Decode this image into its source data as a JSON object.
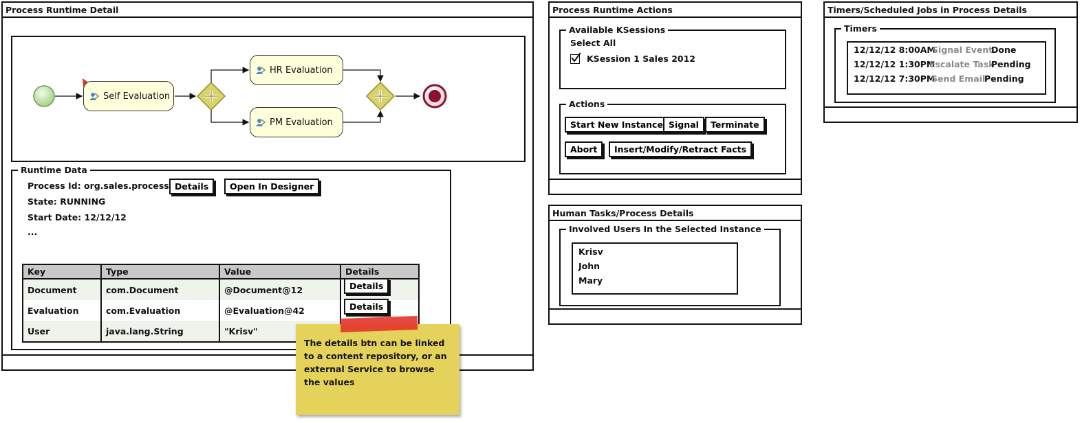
{
  "runtime_detail": {
    "title": "Process Runtime Detail",
    "diagram": {
      "tasks": [
        {
          "label": "Self Evaluation"
        },
        {
          "label": "HR Evaluation"
        },
        {
          "label": "PM Evaluation"
        }
      ],
      "colors": {
        "start": "#b9e3a0",
        "end": "#8e1030",
        "gateway": "#c6c24a",
        "task": "#ffffdc",
        "marker": "#e4342a"
      }
    },
    "runtime_data": {
      "legend": "Runtime Data",
      "process_id": "Process Id: org.sales.process",
      "state": "State: RUNNING",
      "start_date": "Start Date: 12/12/12",
      "more": "...",
      "details_button": "Details",
      "open_designer_button": "Open In Designer",
      "table": {
        "headers": [
          "Key",
          "Type",
          "Value",
          "Details"
        ],
        "rows": [
          {
            "key": "Document",
            "type": "com.Document",
            "value": "@Document@12",
            "details": "Details"
          },
          {
            "key": "Evaluation",
            "type": "com.Evaluation",
            "value": "@Evaluation@42",
            "details": "Details"
          },
          {
            "key": "User",
            "type": "java.lang.String",
            "value": "\"Krisv\"",
            "details": ""
          }
        ]
      }
    },
    "sticky_note": "The details btn can be linked to a content repository, or an external Service to browse the values"
  },
  "runtime_actions": {
    "title": "Process Runtime Actions",
    "ksessions": {
      "legend": "Available KSessions",
      "select_all": "Select All",
      "item": "KSession 1 Sales 2012",
      "checked": true
    },
    "actions": {
      "legend": "Actions",
      "start_new_instance": "Start New Instance",
      "signal": "Signal",
      "terminate": "Terminate",
      "abort": "Abort",
      "facts": "Insert/Modify/Retract Facts"
    }
  },
  "human_tasks": {
    "title": "Human Tasks/Process Details",
    "legend": "Involved Users In the Selected Instance",
    "users": [
      "Krisv",
      "John",
      "Mary"
    ]
  },
  "timers": {
    "title": "Timers/Scheduled Jobs in Process Details",
    "legend": "Timers",
    "rows": [
      {
        "time": "12/12/12 8:00AM",
        "action": "Signal Event",
        "status": "Done"
      },
      {
        "time": "12/12/12 1:30PM",
        "action": "Escalate Task",
        "status": "Pending"
      },
      {
        "time": "12/12/12 7:30PM",
        "action": "Send Email",
        "status": "Pending"
      }
    ]
  }
}
